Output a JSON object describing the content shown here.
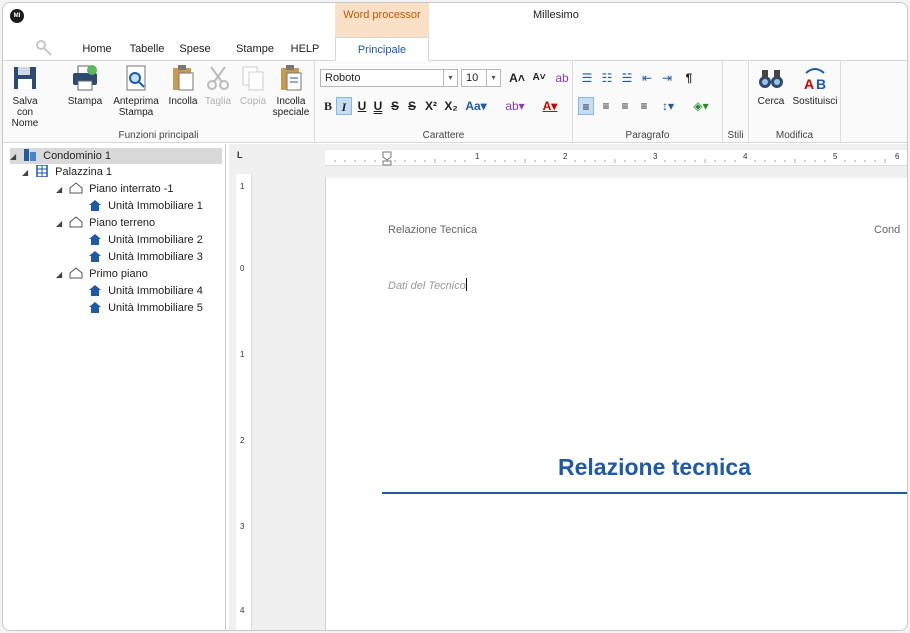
{
  "app": {
    "logo_text": "MI",
    "title": "Millesimo",
    "context_tab_header": "Word processor"
  },
  "tabs": [
    "Home",
    "Tabelle",
    "Spese",
    "Stampe",
    "HELP",
    "Principale"
  ],
  "active_tab": "Principale",
  "ribbon": {
    "funzioni": {
      "label": "Funzioni principali",
      "buttons": [
        {
          "label": "Salva con Nome",
          "icon": "save-icon"
        },
        {
          "label": "Stampa",
          "icon": "print-icon"
        },
        {
          "label": "Anteprima Stampa",
          "icon": "print-preview-icon"
        },
        {
          "label": "Incolla",
          "icon": "paste-icon"
        },
        {
          "label": "Taglia",
          "icon": "cut-icon",
          "disabled": true
        },
        {
          "label": "Copia",
          "icon": "copy-icon",
          "disabled": true
        },
        {
          "label": "Incolla speciale",
          "icon": "paste-special-icon"
        }
      ]
    },
    "carattere": {
      "label": "Carattere",
      "font": "Roboto",
      "size": "10"
    },
    "paragrafo": {
      "label": "Paragrafo"
    },
    "stili": {
      "label": "Stili"
    },
    "modifica": {
      "label": "Modifica",
      "buttons": [
        {
          "label": "Cerca",
          "icon": "binoculars-icon"
        },
        {
          "label": "Sostituisci",
          "icon": "replace-icon"
        }
      ]
    }
  },
  "tree": [
    {
      "label": "Condominio 1",
      "icon": "building-icon",
      "selected": true
    },
    {
      "label": "Palazzina 1",
      "icon": "palazzina-icon"
    },
    {
      "label": "Piano interrato -1",
      "icon": "floor-icon"
    },
    {
      "label": "Unità Immobiliare 1",
      "icon": "home-icon"
    },
    {
      "label": "Piano terreno",
      "icon": "floor-icon"
    },
    {
      "label": "Unità Immobiliare 2",
      "icon": "home-icon"
    },
    {
      "label": "Unità Immobiliare 3",
      "icon": "home-icon"
    },
    {
      "label": "Primo piano",
      "icon": "floor-icon"
    },
    {
      "label": "Unità Immobiliare 4",
      "icon": "home-icon"
    },
    {
      "label": "Unità Immobiliare 5",
      "icon": "home-icon"
    }
  ],
  "ruler": {
    "h_numbers": [
      "1",
      "2",
      "3",
      "4",
      "5",
      "6"
    ],
    "v_numbers": [
      "1",
      "0",
      "1",
      "2",
      "3",
      "4"
    ]
  },
  "document": {
    "header_left": "Relazione Tecnica",
    "header_right": "Cond",
    "dati": "Dati del Tecnico",
    "title": "Relazione tecnica"
  },
  "colors": {
    "accent": "#1e5aa8",
    "context_tab_bg": "#f9e0c7",
    "context_tab_text": "#c05a00"
  }
}
